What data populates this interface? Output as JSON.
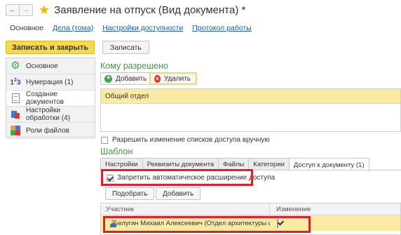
{
  "window": {
    "back_icon": "←",
    "forward_icon": "→",
    "title": "Заявление на отпуск (Вид документа) *"
  },
  "nav_tabs": [
    {
      "label": "Основное"
    },
    {
      "label": "Дела (тома)"
    },
    {
      "label": "Настройки доступности"
    },
    {
      "label": "Протокол работы"
    }
  ],
  "toolbar": {
    "save_close_label": "Записать и закрыть",
    "save_label": "Записать"
  },
  "sidebar": {
    "items": [
      {
        "label": "Основное",
        "icon": "gear-icon"
      },
      {
        "label": "Нумерация (1)",
        "icon": "numbering-icon"
      },
      {
        "label": "Создание документов",
        "icon": "document-icon"
      },
      {
        "label": "Настройки обработки (4)",
        "icon": "processing-settings-icon"
      },
      {
        "label": "Роли файлов",
        "icon": "file-roles-icon"
      }
    ]
  },
  "allowed": {
    "title": "Кому разрешено",
    "add_label": "Добавить",
    "delete_label": "Удалить",
    "rows": [
      {
        "name": "Общий отдел"
      }
    ],
    "allow_manual_change_label": "Разрешить изменение списков доступа вручную"
  },
  "template": {
    "title": "Шаблон",
    "tabs": [
      {
        "label": "Настройки"
      },
      {
        "label": "Реквизиты документа"
      },
      {
        "label": "Файлы"
      },
      {
        "label": "Категории"
      },
      {
        "label": "Доступ к документу (1)"
      }
    ],
    "forbid_auto_extend_label": "Запретить автоматическое расширение доступа",
    "forbid_auto_extend_checked": true,
    "select_label": "Подобрать",
    "add_label": "Добавить",
    "columns": {
      "participant": "Участник",
      "change": "Изменение"
    },
    "rows": [
      {
        "participant": "Белугин Михаил Алексеевич (Отдел архитектуры и...",
        "change": true
      }
    ]
  },
  "colors": {
    "accent_green": "#3d9a3b",
    "primary_button": "#f6d84a",
    "selection": "#fbeaa4",
    "highlight_box": "#e0202a"
  }
}
